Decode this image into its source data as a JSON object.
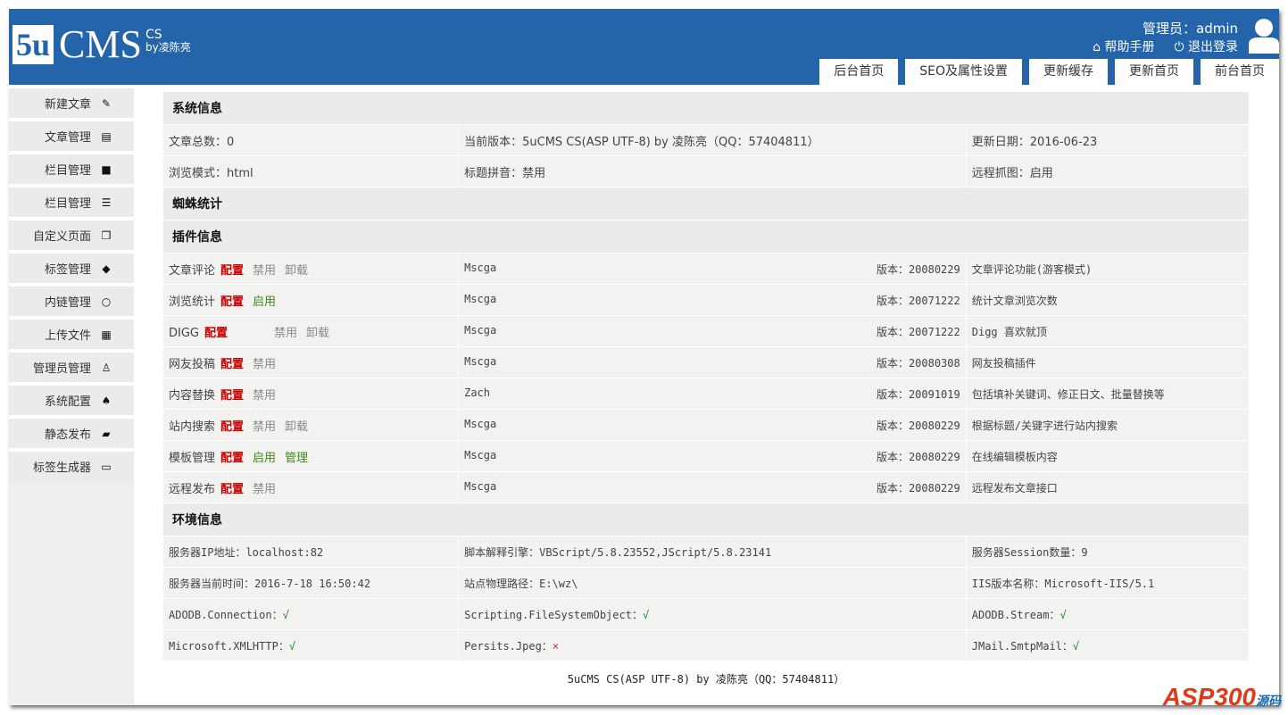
{
  "header": {
    "logo_box": "5u",
    "logo_main": "CMS",
    "logo_sup": "CS",
    "logo_by": "by凌陈亮",
    "user": "管理员：admin",
    "help": "帮助手册",
    "logout": "退出登录",
    "tabs": [
      "后台首页",
      "SEO及属性设置",
      "更新缓存",
      "更新首页",
      "前台首页"
    ]
  },
  "sidebar": [
    {
      "label": "新建文章",
      "icon": "✎"
    },
    {
      "label": "文章管理",
      "icon": "▤"
    },
    {
      "label": "栏目管理",
      "icon": "■"
    },
    {
      "label": "栏目管理",
      "icon": "☰"
    },
    {
      "label": "自定义页面",
      "icon": "❐"
    },
    {
      "label": "标签管理",
      "icon": "◆"
    },
    {
      "label": "内链管理",
      "icon": "○"
    },
    {
      "label": "上传文件",
      "icon": "▦"
    },
    {
      "label": "管理员管理",
      "icon": "♙"
    },
    {
      "label": "系统配置",
      "icon": "♠"
    },
    {
      "label": "静态发布",
      "icon": "▰"
    },
    {
      "label": "标签生成器",
      "icon": "▭"
    }
  ],
  "system": {
    "title": "系统信息",
    "rows": [
      [
        "文章总数：0",
        "当前版本：5uCMS CS(ASP UTF-8) by 凌陈亮（QQ：57404811）",
        "更新日期：2016-06-23"
      ],
      [
        "浏览模式：html",
        "标题拼音：禁用",
        "远程抓图：启用"
      ]
    ]
  },
  "spider": {
    "title": "蜘蛛统计"
  },
  "plugins": {
    "title": "插件信息",
    "config_label": "配置",
    "rows": [
      {
        "name": "文章评论",
        "actions": [
          [
            "禁用",
            "gray"
          ],
          [
            "卸载",
            "gray"
          ]
        ],
        "author": "Mscga",
        "version": "版本：20080229",
        "desc": "文章评论功能(游客模式)"
      },
      {
        "name": "浏览统计",
        "actions": [
          [
            "启用",
            "green"
          ]
        ],
        "author": "Mscga",
        "version": "版本：20071222",
        "desc": "统计文章浏览次数"
      },
      {
        "name": "DIGG",
        "actions": [
          [
            "禁用",
            "gray"
          ],
          [
            "卸载",
            "gray"
          ]
        ],
        "author": "Mscga",
        "version": "版本：20071222",
        "desc": "Digg 喜欢就顶"
      },
      {
        "name": "网友投稿",
        "actions": [
          [
            "禁用",
            "gray"
          ]
        ],
        "author": "Mscga",
        "version": "版本：20080308",
        "desc": "网友投稿插件"
      },
      {
        "name": "内容替换",
        "actions": [
          [
            "禁用",
            "gray"
          ]
        ],
        "author": "Zach",
        "version": "版本：20091019",
        "desc": "包括填补关键词、修正日文、批量替换等"
      },
      {
        "name": "站内搜索",
        "actions": [
          [
            "禁用",
            "gray"
          ],
          [
            "卸载",
            "gray"
          ]
        ],
        "author": "Mscga",
        "version": "版本：20080229",
        "desc": "根据标题/关键字进行站内搜索"
      },
      {
        "name": "模板管理",
        "actions": [
          [
            "启用",
            "green"
          ],
          [
            "管理",
            "green"
          ]
        ],
        "author": "Mscga",
        "version": "版本：20080229",
        "desc": "在线编辑模板内容"
      },
      {
        "name": "远程发布",
        "actions": [
          [
            "禁用",
            "gray"
          ]
        ],
        "author": "Mscga",
        "version": "版本：20080229",
        "desc": "远程发布文章接口"
      }
    ]
  },
  "env": {
    "title": "环境信息",
    "rows": [
      [
        [
          "服务器IP地址：localhost:82",
          ""
        ],
        [
          "脚本解释引擎：VBScript/5.8.23552,JScript/5.8.23141",
          ""
        ],
        [
          "服务器Session数量：9",
          ""
        ]
      ],
      [
        [
          "服务器当前时间：2016-7-18 16:50:42",
          ""
        ],
        [
          "站点物理路径：E:\\wz\\",
          ""
        ],
        [
          "IIS版本名称：Microsoft-IIS/5.1",
          ""
        ]
      ],
      [
        [
          "ADODB.Connection：",
          "√"
        ],
        [
          "Scripting.FileSystemObject：",
          "√"
        ],
        [
          "ADODB.Stream：",
          "√"
        ]
      ],
      [
        [
          "Microsoft.XMLHTTP：",
          "√"
        ],
        [
          "Persits.Jpeg：",
          "×"
        ],
        [
          "JMail.SmtpMail：",
          "√"
        ]
      ]
    ]
  },
  "footer": "5uCMS CS(ASP UTF-8) by 凌陈亮（QQ：57404811）",
  "watermark": {
    "text": "ASP300",
    "sub": "源码"
  },
  "colors": {
    "header": "#2364aa",
    "config": "#cc0000",
    "enabled": "#3a8a1a",
    "ok": "#1a8a1a",
    "fail": "#dd3333"
  }
}
